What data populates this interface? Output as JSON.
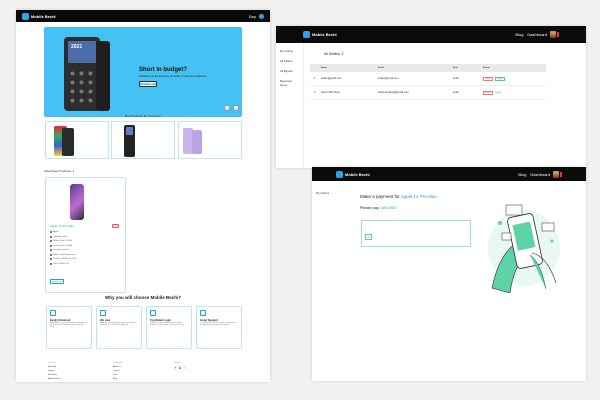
{
  "store": {
    "brand": "Mobile Bechi",
    "nav_login": "Buy",
    "hero": {
      "phone_screen": "2021",
      "title": "Short in budget?",
      "subtitle": "Instalment on the purchase of mobile on your new Instalment",
      "button": "Purchase now",
      "prev": "‹",
      "next": "›"
    },
    "category_label": "Buy Products By Company",
    "products_label": "Advertised Products: 1",
    "product": {
      "name": "Apple 14 Pro Max",
      "badge": "Rent",
      "specs": [
        "Apple",
        "Condition: New",
        "Market Price: 1200$",
        "Resale Price: 1000$",
        "Location: Lahore",
        "Seller: seller@gmail.com",
        "Posted: 2023-01-19, 8:26",
        "Year: 2023-01-19"
      ],
      "button": "Book Now"
    },
    "why_title": "Why you will choose Mobile Bechi?",
    "features": [
      {
        "title": "Easily Returned",
        "text": "Mobile Bechi is a place where sellers and buyers can sell and return their products easily without any hassle."
      },
      {
        "title": "We care",
        "text": "Mobile Bechi cares for every buyer. Every product is verified by our admins before going live."
      },
      {
        "title": "Top Rated Login",
        "text": "Mobile Bechi gives login from several trusted providers so your account stays safe and secure."
      },
      {
        "title": "Great Support",
        "text": "Our support team is here to answer every question you have about any product and payment."
      }
    ],
    "footer": [
      {
        "head": "Services",
        "items": [
          "Branding",
          "Design",
          "Marketing",
          "Advertisement"
        ]
      },
      {
        "head": "Company",
        "items": [
          "About us",
          "Contact",
          "Jobs",
          "Blog"
        ]
      },
      {
        "head": "Social",
        "items": []
      }
    ],
    "social_icons": [
      "twitter-icon",
      "youtube-icon",
      "facebook-icon"
    ]
  },
  "admin": {
    "brand": "Mobile Bechi",
    "nav": [
      "Blog",
      "Dashboard"
    ],
    "menu": [
      "My Orders",
      "All Sellers",
      "All Buyers",
      "Reported Items"
    ],
    "title": "All Sellers: 2",
    "columns": [
      "",
      "Name",
      "Email",
      "Role",
      "Action"
    ],
    "rows": [
      {
        "idx": "1",
        "name": "seller@gmail.com",
        "email": "seller@gmail.com",
        "role": "seller",
        "del": "Delete",
        "action": "Verify"
      },
      {
        "idx": "2",
        "name": "Tanjim Bin Reza",
        "email": "tanjimreza122@gmail.com",
        "role": "seller",
        "del": "Delete",
        "action": "Verified"
      }
    ]
  },
  "payment": {
    "brand": "Mobile Bechi",
    "nav": [
      "Blog",
      "Dashboard"
    ],
    "menu": "My Orders",
    "title_prefix": "Make a payment for",
    "title_item": "Apple 14 Pro Max",
    "amount_prefix": "Please pay",
    "amount_value": "1000 BDT",
    "pay_button": "Pay"
  },
  "colors": {
    "accent": "#1aa4c8",
    "hero_bg": "#45c1f3",
    "navbar": "#0b0b0b",
    "illustration": "#5fd3a8"
  }
}
